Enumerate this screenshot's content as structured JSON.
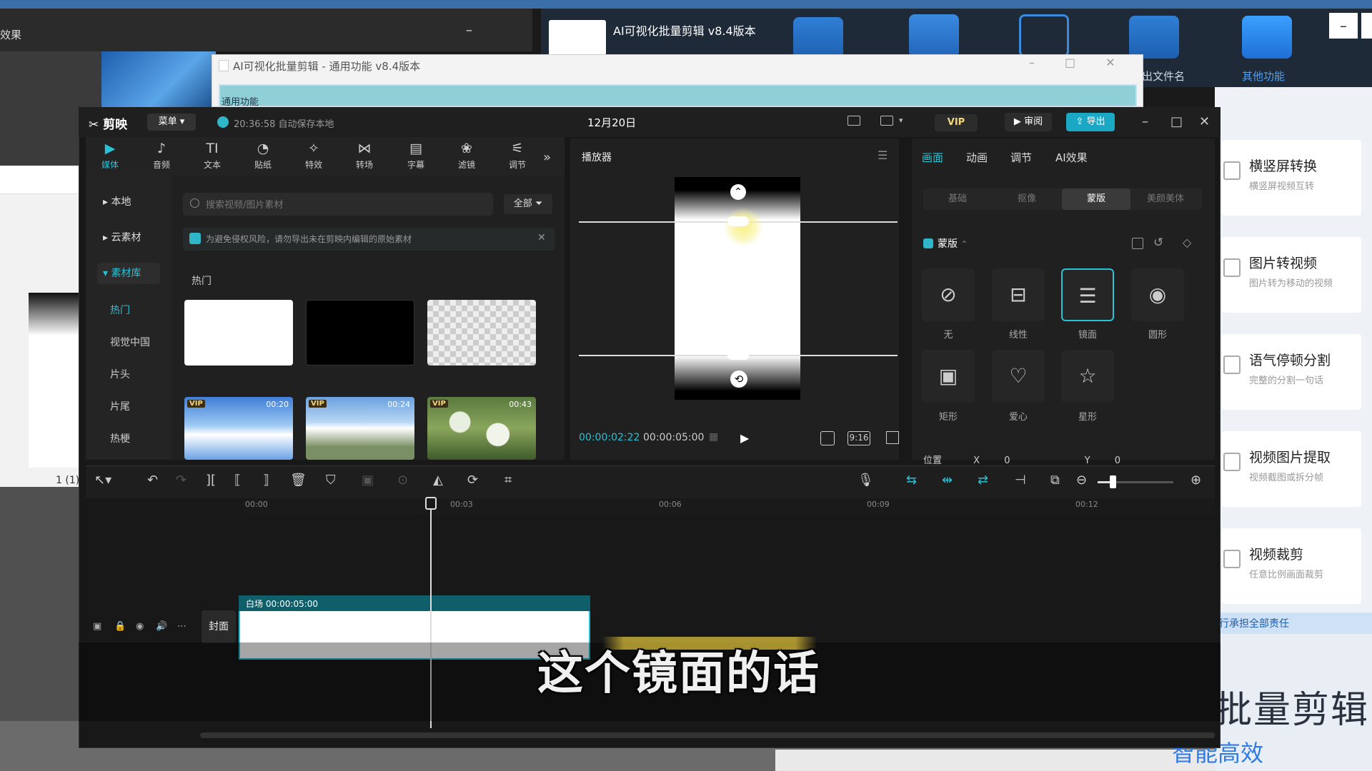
{
  "background": {
    "left_window_title": "效果",
    "top_app_title": "AI可视化批量剪辑 v8.4版本",
    "top_app_labels": [
      "出文件名",
      "其他功能"
    ],
    "middle_window_title": "AI可视化批量剪辑 - 通用功能  v8.4版本",
    "middle_window_tab": "通用功能",
    "doc_page": "1 (1)",
    "right_cards": [
      {
        "title": "横竖屏转换",
        "sub": "横竖屏视频互转"
      },
      {
        "title": "图片转视频",
        "sub": "图片转为移动的视频"
      },
      {
        "title": "语气停顿分割",
        "sub": "完整的分割一句话"
      },
      {
        "title": "视频图片提取",
        "sub": "视频截图或拆分帧"
      },
      {
        "title": "视频裁剪",
        "sub": "任意比例画面裁剪"
      }
    ],
    "right_footer": "行承担全部责任",
    "big_text": "批量剪辑",
    "big_text2": "智能高效",
    "accent_color": "#28c2d6"
  },
  "app": {
    "logo": "剪映",
    "menu": "菜单",
    "save_status": "20:36:58 自动保存本地",
    "date_title": "12月20日",
    "vip": "VIP",
    "review": "审阅",
    "export": "导出"
  },
  "tools": [
    {
      "label": "媒体",
      "icon": "▶"
    },
    {
      "label": "音频",
      "icon": "♪"
    },
    {
      "label": "文本",
      "icon": "TI"
    },
    {
      "label": "贴纸",
      "icon": "◔"
    },
    {
      "label": "特效",
      "icon": "✧"
    },
    {
      "label": "转场",
      "icon": "⋈"
    },
    {
      "label": "字幕",
      "icon": "▤"
    },
    {
      "label": "滤镜",
      "icon": "❀"
    },
    {
      "label": "调节",
      "icon": "⚟"
    }
  ],
  "media": {
    "side": [
      "本地",
      "云素材",
      "素材库"
    ],
    "sub": [
      "热门",
      "视觉中国",
      "片头",
      "片尾",
      "热梗"
    ],
    "search_placeholder": "搜索视频/图片素材",
    "filter": "全部",
    "notice": "为避免侵权风险，请勿导出未在剪映内编辑的原始素材",
    "section": "热门",
    "thumbs": [
      {
        "vip": "VIP",
        "duration": "00:20"
      },
      {
        "vip": "VIP",
        "duration": "00:24"
      },
      {
        "vip": "VIP",
        "duration": "00:43"
      }
    ]
  },
  "player": {
    "title": "播放器",
    "time_current": "00:00:02:22",
    "time_total": "00:00:05:00",
    "ratio": "9:16"
  },
  "props": {
    "tabs": [
      "画面",
      "动画",
      "调节",
      "AI效果"
    ],
    "subtabs": [
      "基础",
      "抠像",
      "蒙版",
      "美颜美体"
    ],
    "mask_title": "蒙版",
    "shapes": [
      "无",
      "线性",
      "镜面",
      "圆形",
      "矩形",
      "爱心",
      "星形"
    ],
    "position_label": "位置",
    "x_label": "X",
    "x_value": "0",
    "y_label": "Y",
    "y_value": "0"
  },
  "timeline": {
    "ticks": [
      "00:00",
      "00:03",
      "00:06",
      "00:09",
      "00:12"
    ],
    "cover": "封面",
    "clip_label": "白场  00:00:05:00"
  },
  "subtitle": "这个镜面的话"
}
